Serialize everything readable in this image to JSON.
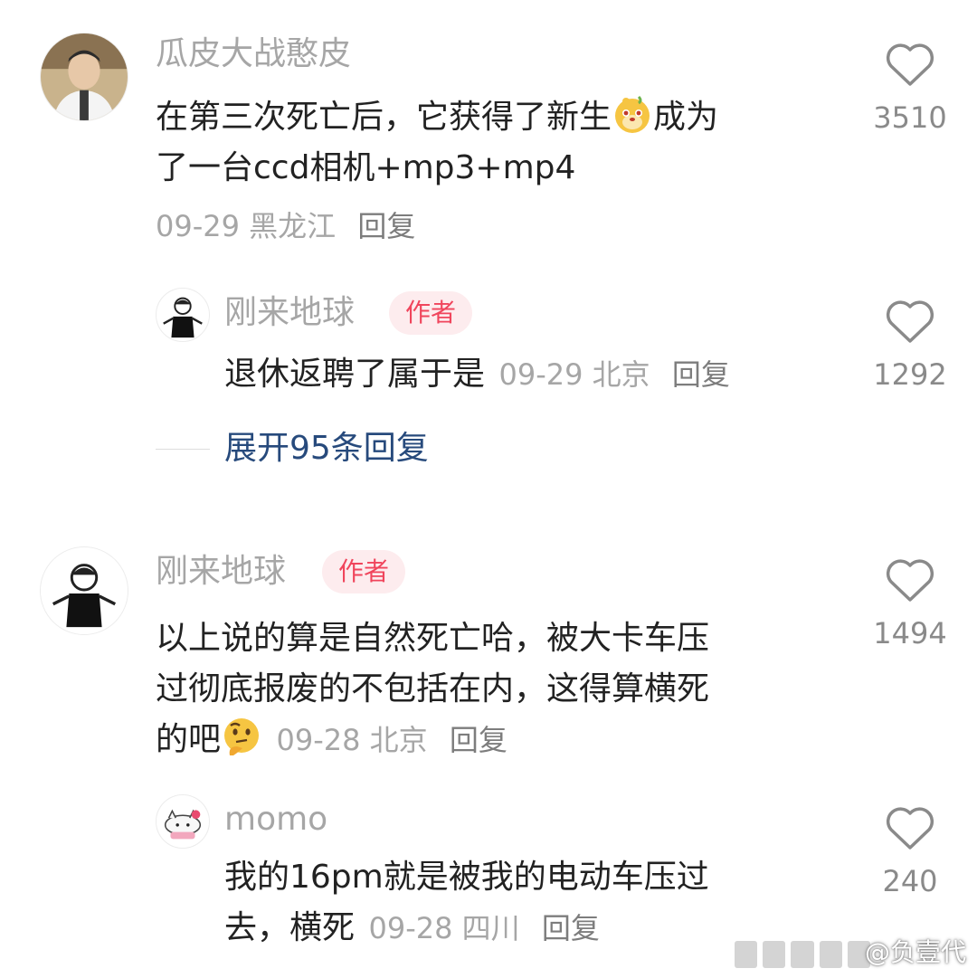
{
  "comments": [
    {
      "username": "瓜皮大战憨皮",
      "text_line1": "在第三次死亡后，它获得了新生",
      "text_line1_after": "成为",
      "text_line2": "了一台ccd相机+mp3+mp4",
      "date": "09-29",
      "location": "黑龙江",
      "reply_label": "回复",
      "likes": "3510",
      "emoji": "leopard-face-emoji",
      "replies": [
        {
          "username": "刚来地球",
          "badge": "作者",
          "text": "退休返聘了属于是",
          "date": "09-29",
          "location": "北京",
          "reply_label": "回复",
          "likes": "1292"
        }
      ],
      "expand_label": "展开95条回复"
    },
    {
      "username": "刚来地球",
      "badge": "作者",
      "text_line1": "以上说的算是自然死亡哈，被大卡车压",
      "text_line2": "过彻底报废的不包括在内，这得算横死",
      "text_line3": "的吧",
      "emoji": "thinking-face-emoji",
      "date": "09-28",
      "location": "北京",
      "reply_label": "回复",
      "likes": "1494",
      "replies": [
        {
          "username": "momo",
          "text_line1": "我的16pm就是被我的电动车压过",
          "text_line2": "去，横死",
          "date": "09-28",
          "location": "四川",
          "reply_label": "回复",
          "likes": "240"
        }
      ]
    }
  ],
  "watermark": "@负壹代",
  "colors": {
    "username": "#a6a6a6",
    "badge_bg": "#fdecee",
    "badge_text": "#f0455c",
    "expand_link": "#274a7c",
    "meta": "#a6a6a6"
  }
}
